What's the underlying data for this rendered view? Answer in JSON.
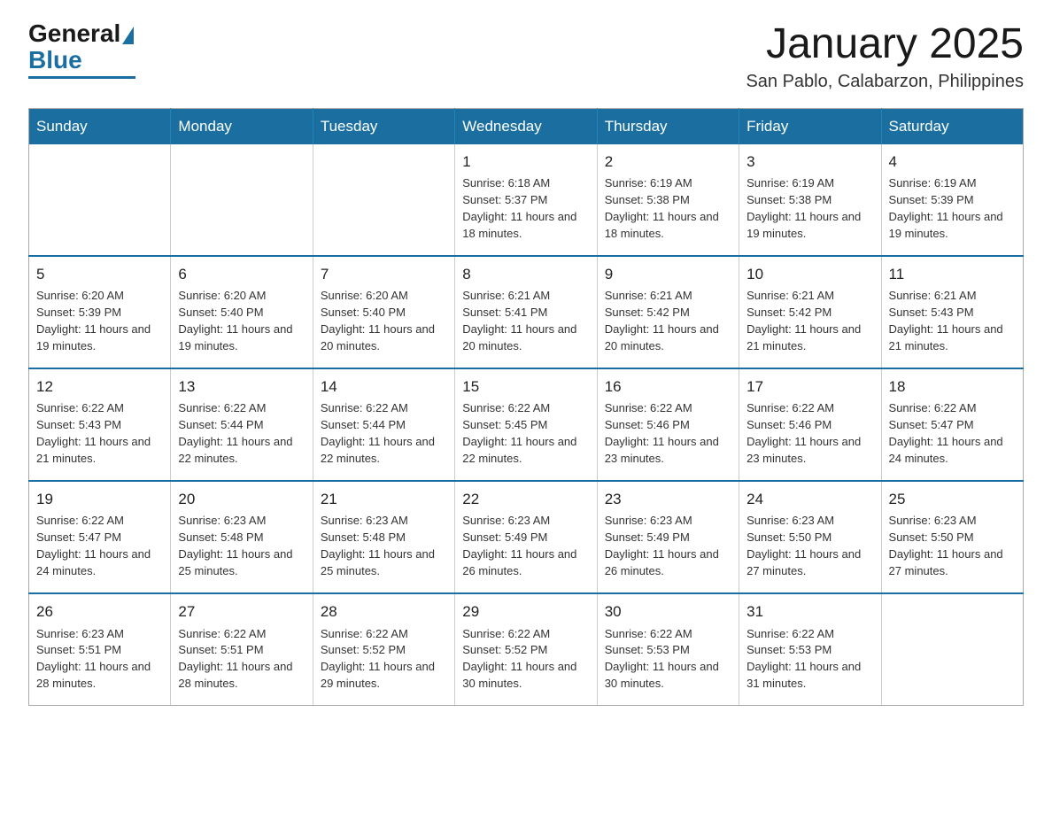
{
  "logo": {
    "general": "General",
    "blue": "Blue"
  },
  "title": "January 2025",
  "subtitle": "San Pablo, Calabarzon, Philippines",
  "days_of_week": [
    "Sunday",
    "Monday",
    "Tuesday",
    "Wednesday",
    "Thursday",
    "Friday",
    "Saturday"
  ],
  "weeks": [
    [
      {
        "day": "",
        "info": ""
      },
      {
        "day": "",
        "info": ""
      },
      {
        "day": "",
        "info": ""
      },
      {
        "day": "1",
        "info": "Sunrise: 6:18 AM\nSunset: 5:37 PM\nDaylight: 11 hours and 18 minutes."
      },
      {
        "day": "2",
        "info": "Sunrise: 6:19 AM\nSunset: 5:38 PM\nDaylight: 11 hours and 18 minutes."
      },
      {
        "day": "3",
        "info": "Sunrise: 6:19 AM\nSunset: 5:38 PM\nDaylight: 11 hours and 19 minutes."
      },
      {
        "day": "4",
        "info": "Sunrise: 6:19 AM\nSunset: 5:39 PM\nDaylight: 11 hours and 19 minutes."
      }
    ],
    [
      {
        "day": "5",
        "info": "Sunrise: 6:20 AM\nSunset: 5:39 PM\nDaylight: 11 hours and 19 minutes."
      },
      {
        "day": "6",
        "info": "Sunrise: 6:20 AM\nSunset: 5:40 PM\nDaylight: 11 hours and 19 minutes."
      },
      {
        "day": "7",
        "info": "Sunrise: 6:20 AM\nSunset: 5:40 PM\nDaylight: 11 hours and 20 minutes."
      },
      {
        "day": "8",
        "info": "Sunrise: 6:21 AM\nSunset: 5:41 PM\nDaylight: 11 hours and 20 minutes."
      },
      {
        "day": "9",
        "info": "Sunrise: 6:21 AM\nSunset: 5:42 PM\nDaylight: 11 hours and 20 minutes."
      },
      {
        "day": "10",
        "info": "Sunrise: 6:21 AM\nSunset: 5:42 PM\nDaylight: 11 hours and 21 minutes."
      },
      {
        "day": "11",
        "info": "Sunrise: 6:21 AM\nSunset: 5:43 PM\nDaylight: 11 hours and 21 minutes."
      }
    ],
    [
      {
        "day": "12",
        "info": "Sunrise: 6:22 AM\nSunset: 5:43 PM\nDaylight: 11 hours and 21 minutes."
      },
      {
        "day": "13",
        "info": "Sunrise: 6:22 AM\nSunset: 5:44 PM\nDaylight: 11 hours and 22 minutes."
      },
      {
        "day": "14",
        "info": "Sunrise: 6:22 AM\nSunset: 5:44 PM\nDaylight: 11 hours and 22 minutes."
      },
      {
        "day": "15",
        "info": "Sunrise: 6:22 AM\nSunset: 5:45 PM\nDaylight: 11 hours and 22 minutes."
      },
      {
        "day": "16",
        "info": "Sunrise: 6:22 AM\nSunset: 5:46 PM\nDaylight: 11 hours and 23 minutes."
      },
      {
        "day": "17",
        "info": "Sunrise: 6:22 AM\nSunset: 5:46 PM\nDaylight: 11 hours and 23 minutes."
      },
      {
        "day": "18",
        "info": "Sunrise: 6:22 AM\nSunset: 5:47 PM\nDaylight: 11 hours and 24 minutes."
      }
    ],
    [
      {
        "day": "19",
        "info": "Sunrise: 6:22 AM\nSunset: 5:47 PM\nDaylight: 11 hours and 24 minutes."
      },
      {
        "day": "20",
        "info": "Sunrise: 6:23 AM\nSunset: 5:48 PM\nDaylight: 11 hours and 25 minutes."
      },
      {
        "day": "21",
        "info": "Sunrise: 6:23 AM\nSunset: 5:48 PM\nDaylight: 11 hours and 25 minutes."
      },
      {
        "day": "22",
        "info": "Sunrise: 6:23 AM\nSunset: 5:49 PM\nDaylight: 11 hours and 26 minutes."
      },
      {
        "day": "23",
        "info": "Sunrise: 6:23 AM\nSunset: 5:49 PM\nDaylight: 11 hours and 26 minutes."
      },
      {
        "day": "24",
        "info": "Sunrise: 6:23 AM\nSunset: 5:50 PM\nDaylight: 11 hours and 27 minutes."
      },
      {
        "day": "25",
        "info": "Sunrise: 6:23 AM\nSunset: 5:50 PM\nDaylight: 11 hours and 27 minutes."
      }
    ],
    [
      {
        "day": "26",
        "info": "Sunrise: 6:23 AM\nSunset: 5:51 PM\nDaylight: 11 hours and 28 minutes."
      },
      {
        "day": "27",
        "info": "Sunrise: 6:22 AM\nSunset: 5:51 PM\nDaylight: 11 hours and 28 minutes."
      },
      {
        "day": "28",
        "info": "Sunrise: 6:22 AM\nSunset: 5:52 PM\nDaylight: 11 hours and 29 minutes."
      },
      {
        "day": "29",
        "info": "Sunrise: 6:22 AM\nSunset: 5:52 PM\nDaylight: 11 hours and 30 minutes."
      },
      {
        "day": "30",
        "info": "Sunrise: 6:22 AM\nSunset: 5:53 PM\nDaylight: 11 hours and 30 minutes."
      },
      {
        "day": "31",
        "info": "Sunrise: 6:22 AM\nSunset: 5:53 PM\nDaylight: 11 hours and 31 minutes."
      },
      {
        "day": "",
        "info": ""
      }
    ]
  ]
}
